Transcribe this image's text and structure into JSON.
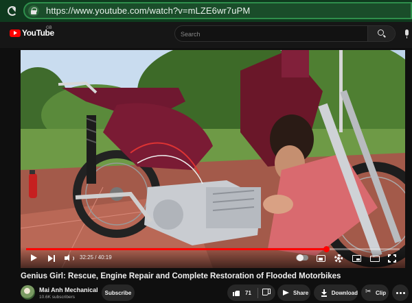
{
  "browser": {
    "url": "https://www.youtube.com/watch?v=mLZE6wr7uPM"
  },
  "header": {
    "logo_text": "YouTube",
    "country_code": "GB",
    "search_placeholder": "Search"
  },
  "player": {
    "current_time": "32:25",
    "duration": "40:19",
    "time_display": "32:25 / 40:19",
    "progress_fraction": 0.804
  },
  "video": {
    "title": "Genius Girl: Rescue, Engine Repair and Complete Restoration of Flooded Motorbikes"
  },
  "channel": {
    "name": "Mai Anh Mechanical",
    "subscribers": "10.6K subscribers"
  },
  "actions": {
    "subscribe_label": "Subscribe",
    "like_count": "71",
    "share_label": "Share",
    "download_label": "Download",
    "clip_label": "Clip"
  },
  "colors": {
    "accent": "#ff0000",
    "address_border": "#2f8f4c",
    "pill_bg": "#272727"
  },
  "icons": [
    "reload-icon",
    "lock-icon",
    "youtube-logo",
    "search-icon",
    "mic-icon",
    "play-icon",
    "next-icon",
    "volume-icon",
    "autoplay-toggle",
    "cc-icon",
    "gear-icon",
    "miniplayer-icon",
    "theater-icon",
    "fullscreen-icon",
    "thumb-up-icon",
    "thumb-down-icon",
    "share-icon",
    "download-icon",
    "clip-icon",
    "more-icon"
  ]
}
